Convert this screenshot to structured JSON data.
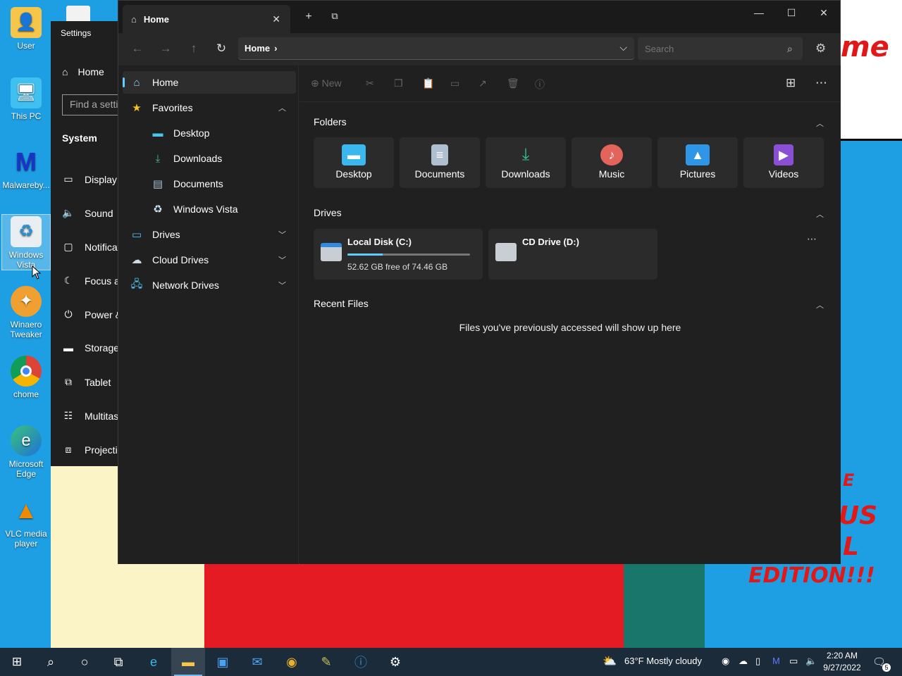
{
  "desktop": {
    "icons": [
      {
        "label": "User",
        "icon": "user-folder-icon"
      },
      {
        "label": "This PC",
        "icon": "this-pc-icon"
      },
      {
        "label": "Malwareby...",
        "icon": "malwarebytes-icon"
      },
      {
        "label": "Windows Vista",
        "icon": "recycle-bin-icon"
      },
      {
        "label": "Winaero Tweaker",
        "icon": "winaero-icon"
      },
      {
        "label": "chome",
        "icon": "chrome-icon"
      },
      {
        "label": "Microsoft Edge",
        "icon": "edge-icon"
      },
      {
        "label": "VLC media player",
        "icon": "vlc-icon"
      }
    ],
    "wallpaper_text": [
      "me",
      "E",
      "US",
      "L",
      "EDITION!!!"
    ]
  },
  "settings": {
    "title": "Settings",
    "home": "Home",
    "search_placeholder": "Find a setting",
    "section": "System",
    "items": [
      "Display",
      "Sound",
      "Notifications & actions",
      "Focus assist",
      "Power & sleep",
      "Storage",
      "Tablet",
      "Multitasking",
      "Projecting to this PC"
    ]
  },
  "files": {
    "tab_title": "Home",
    "address": "Home",
    "search_placeholder": "Search",
    "toolbar": {
      "new_label": "New"
    },
    "sidebar": {
      "home": "Home",
      "favorites": "Favorites",
      "favorites_items": [
        "Desktop",
        "Downloads",
        "Documents",
        "Windows Vista"
      ],
      "drives": "Drives",
      "cloud_drives": "Cloud Drives",
      "network_drives": "Network Drives"
    },
    "sections": {
      "folders": "Folders",
      "drives": "Drives",
      "recent": "Recent Files"
    },
    "folders": [
      "Desktop",
      "Documents",
      "Downloads",
      "Music",
      "Pictures",
      "Videos"
    ],
    "drives": [
      {
        "name": "Local Disk (C:)",
        "detail": "52.62 GB free of 74.46 GB",
        "used_fraction": 0.29
      },
      {
        "name": "CD Drive (D:)",
        "detail": ""
      }
    ],
    "recent_empty": "Files you've previously accessed will show up here"
  },
  "taskbar": {
    "weather": "63°F  Mostly cloudy",
    "time": "2:20 AM",
    "date": "9/27/2022",
    "notification_count": "5"
  },
  "colors": {
    "accent": "#60cdff",
    "window_bg": "#202020",
    "taskbar_bg": "#1c2b3a"
  }
}
